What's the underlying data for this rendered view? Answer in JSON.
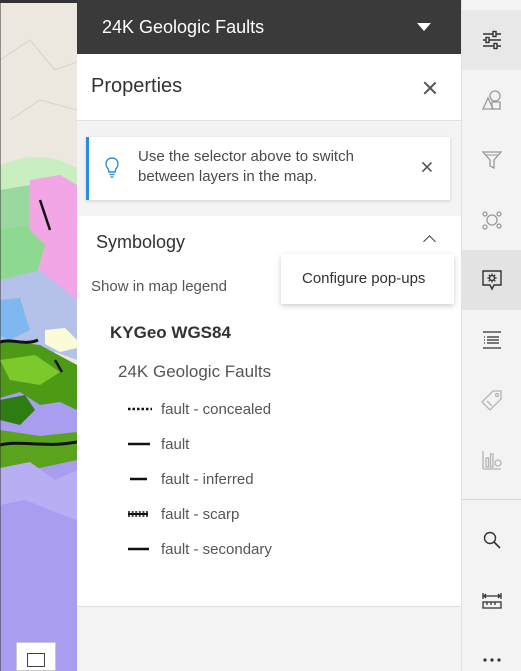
{
  "layer_selector": {
    "title": "24K Geologic Faults"
  },
  "properties": {
    "title": "Properties"
  },
  "notice": {
    "message": "Use the selector above to switch between layers in the map."
  },
  "symbology": {
    "title": "Symbology",
    "legend_toggle_label": "Show in map legend",
    "service_name": "KYGeo WGS84",
    "layer_name": "24K Geologic Faults",
    "items": [
      {
        "label": "fault - concealed",
        "style": "dotted"
      },
      {
        "label": "fault",
        "style": "solid-long"
      },
      {
        "label": "fault - inferred",
        "style": "solid-short"
      },
      {
        "label": "fault - scarp",
        "style": "hatched"
      },
      {
        "label": "fault - secondary",
        "style": "solid-short"
      }
    ]
  },
  "tooltip": {
    "text": "Configure pop-ups"
  },
  "toolbar": {
    "tools": [
      {
        "name": "properties-tool",
        "icon": "sliders-icon",
        "state": "active"
      },
      {
        "name": "styles-tool",
        "icon": "shapes-icon",
        "state": "normal"
      },
      {
        "name": "filter-tool",
        "icon": "filter-icon",
        "state": "normal"
      },
      {
        "name": "clustering-tool",
        "icon": "cluster-icon",
        "state": "normal"
      },
      {
        "name": "configure-popups-tool",
        "icon": "popup-gear-icon",
        "state": "hover"
      },
      {
        "name": "fields-tool",
        "icon": "fields-list-icon",
        "state": "normal"
      },
      {
        "name": "labels-tool",
        "icon": "label-tag-icon",
        "state": "disabled"
      },
      {
        "name": "charts-tool",
        "icon": "chart-gear-icon",
        "state": "disabled"
      },
      {
        "name": "search-tool",
        "icon": "search-icon",
        "state": "normal"
      },
      {
        "name": "measure-tool",
        "icon": "measure-icon",
        "state": "normal"
      },
      {
        "name": "more-tool",
        "icon": "ellipsis-icon",
        "state": "normal"
      }
    ]
  },
  "colors": {
    "header_bg": "#3a3a3a",
    "panel_bg": "#f3f3f3",
    "accent_blue": "#2a8fd6",
    "map_purple": "#a89cf0",
    "map_green": "#4c9a16",
    "map_pink": "#f2a6e6"
  }
}
